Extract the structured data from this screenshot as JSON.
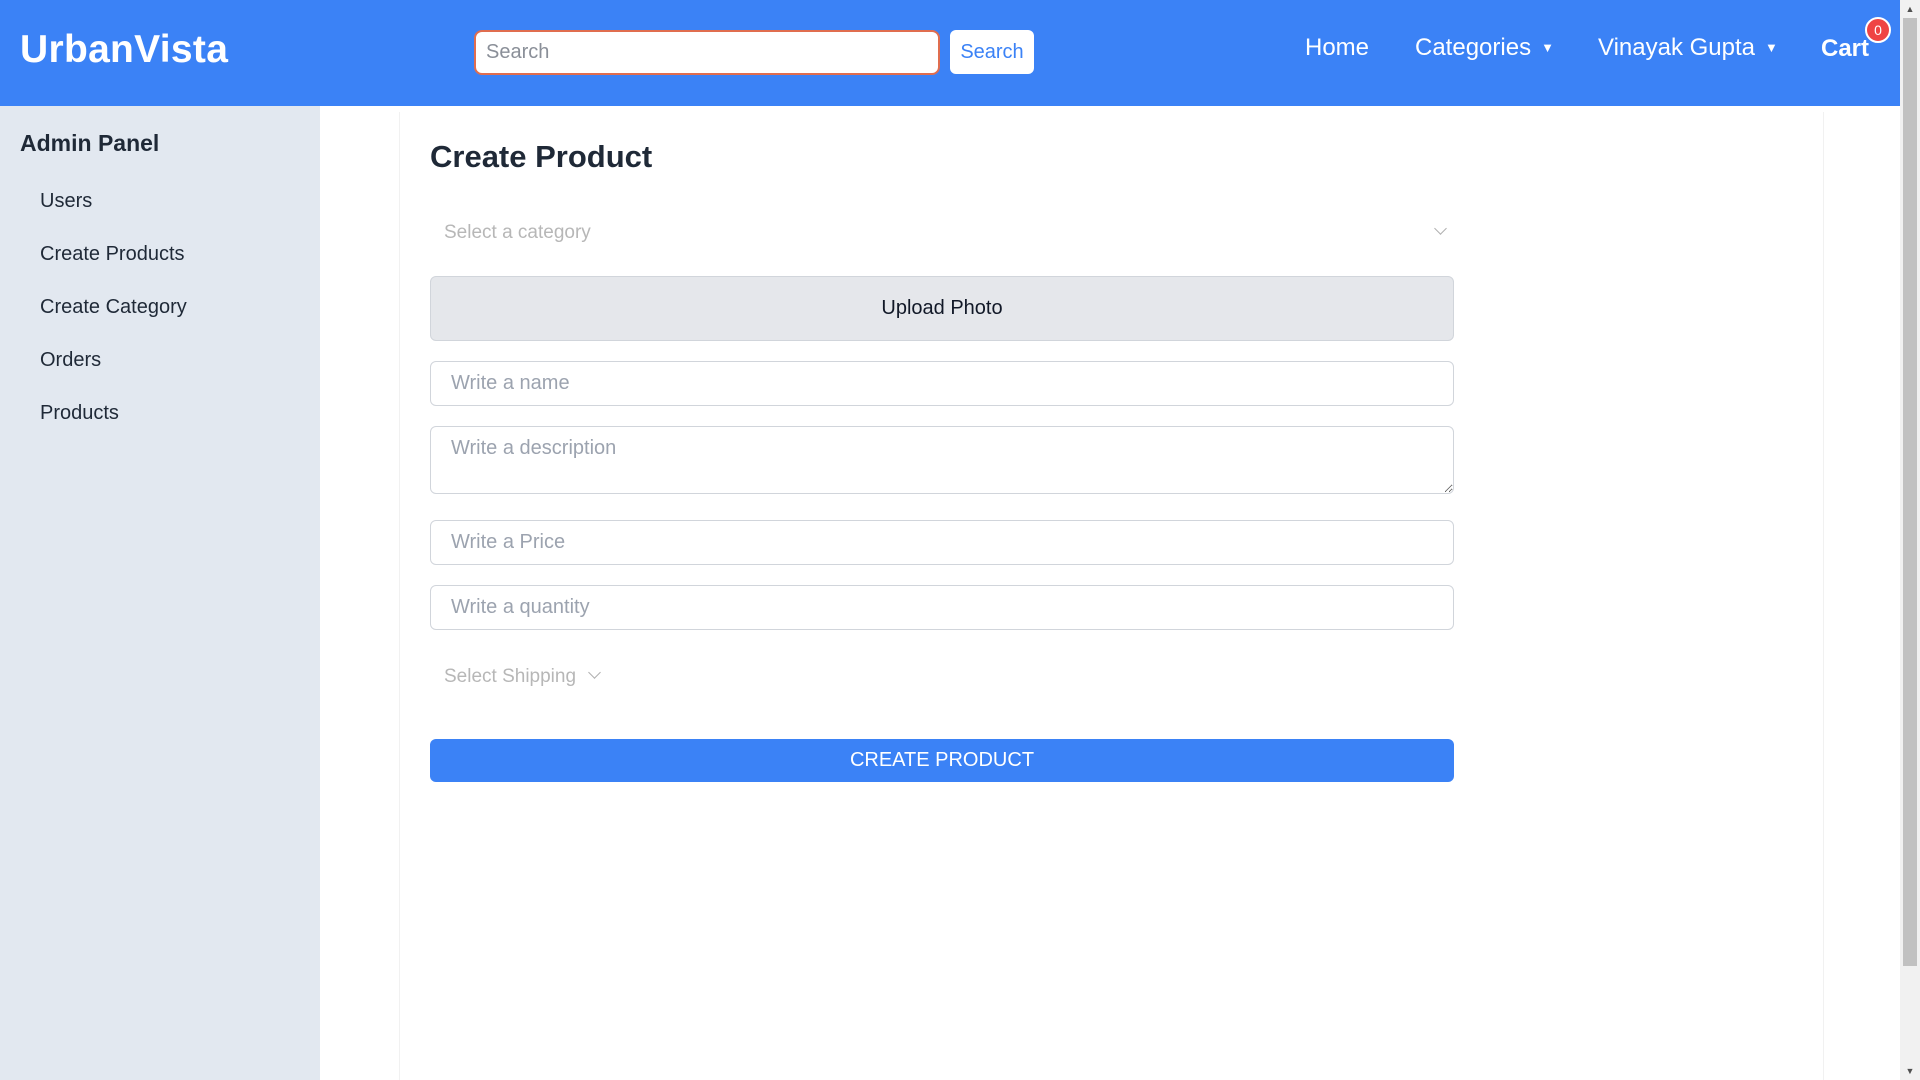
{
  "header": {
    "brand": "UrbanVista",
    "search_placeholder": "Search",
    "search_button": "Search",
    "nav": {
      "home": "Home",
      "categories": "Categories",
      "user": "Vinayak Gupta",
      "cart": "Cart",
      "cart_count": "0"
    },
    "caret": "▼"
  },
  "sidebar": {
    "title": "Admin Panel",
    "items": [
      {
        "label": "Users"
      },
      {
        "label": "Create Products"
      },
      {
        "label": "Create Category"
      },
      {
        "label": "Orders"
      },
      {
        "label": "Products"
      }
    ]
  },
  "form": {
    "title": "Create Product",
    "category_placeholder": "Select a category",
    "upload_label": "Upload Photo",
    "name_placeholder": "Write a name",
    "description_placeholder": "Write a description",
    "price_placeholder": "Write a Price",
    "quantity_placeholder": "Write a quantity",
    "shipping_placeholder": "Select Shipping",
    "submit_label": "CREATE PRODUCT"
  },
  "scrollbar": {
    "up_arrow": "▲",
    "down_arrow": "▼"
  },
  "colors": {
    "primary": "#3b82f6",
    "sidebar_bg": "#e2e8f0",
    "badge": "#ef4444"
  }
}
